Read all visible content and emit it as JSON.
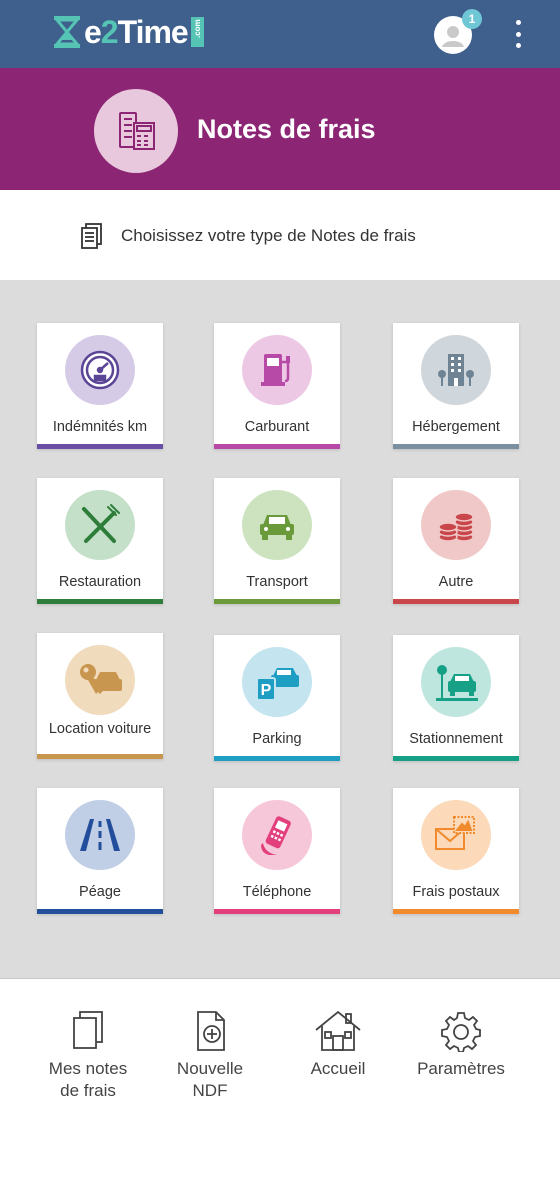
{
  "header": {
    "logo_text_a": "e",
    "logo_text_b": "2",
    "logo_text_c": "Time",
    "logo_dotcom": ".com",
    "notification_count": "1"
  },
  "banner": {
    "title": "Notes de frais",
    "color": "#8c2574"
  },
  "subheader": {
    "text": "Choisissez votre type de Notes de frais"
  },
  "categories": [
    {
      "label": "Indémnités km",
      "icon": "speedometer-icon",
      "color": "#6a4fa3"
    },
    {
      "label": "Carburant",
      "icon": "fuel-pump-icon",
      "color": "#b64aa6"
    },
    {
      "label": "Hébergement",
      "icon": "building-icon",
      "color": "#7a8fa0"
    },
    {
      "label": "Restauration",
      "icon": "cutlery-icon",
      "color": "#2e7d3a"
    },
    {
      "label": "Transport",
      "icon": "car-icon",
      "color": "#6a9a3a"
    },
    {
      "label": "Autre",
      "icon": "coins-icon",
      "color": "#c9474a"
    },
    {
      "label": "Location voiture",
      "icon": "car-key-icon",
      "color": "#c9964f"
    },
    {
      "label": "Parking",
      "icon": "parking-icon",
      "color": "#1f9ec4"
    },
    {
      "label": "Stationnement",
      "icon": "parking-meter-icon",
      "color": "#16a187"
    },
    {
      "label": "Péage",
      "icon": "road-icon",
      "color": "#234e9b"
    },
    {
      "label": "Téléphone",
      "icon": "phone-icon",
      "color": "#e33f7c"
    },
    {
      "label": "Frais postaux",
      "icon": "mail-stamp-icon",
      "color": "#f08a2c"
    }
  ],
  "bottom_nav": [
    {
      "label_1": "Mes notes",
      "label_2": "de frais",
      "icon": "documents-icon"
    },
    {
      "label_1": "Nouvelle",
      "label_2": "NDF",
      "icon": "new-document-icon"
    },
    {
      "label_1": "Accueil",
      "label_2": "",
      "icon": "home-icon"
    },
    {
      "label_1": "Paramètres",
      "label_2": "",
      "icon": "gear-icon"
    }
  ]
}
